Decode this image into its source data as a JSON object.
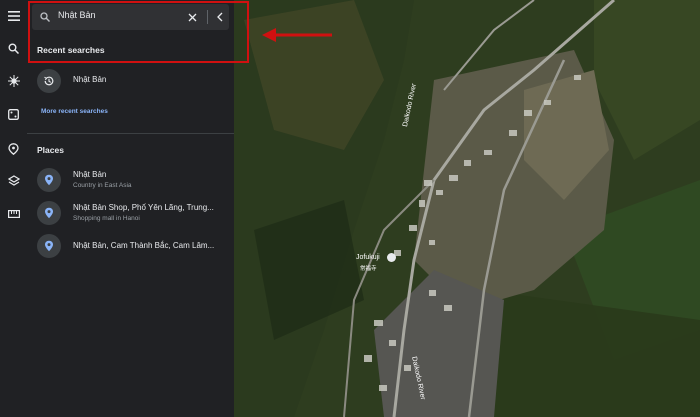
{
  "search": {
    "query": "Nhật Bản"
  },
  "recent": {
    "heading": "Recent searches",
    "items": [
      {
        "title": "Nhật Bản"
      }
    ],
    "more_link": "More recent searches"
  },
  "places": {
    "heading": "Places",
    "items": [
      {
        "title": "Nhật Bản",
        "subtitle": "Country in East Asia"
      },
      {
        "title": "Nhật Bản Shop, Phố Yên Lãng, Trung...",
        "subtitle": "Shopping mall in Hanoi"
      },
      {
        "title": "Nhật Bản, Cam Thành Bắc, Cam Lâm..."
      }
    ]
  },
  "map": {
    "labels": {
      "river_top": "Daikodo River",
      "river_bottom": "Daikodo River",
      "temple": "Jofukuji",
      "temple_jp": "常福寺"
    }
  },
  "colors": {
    "accent": "#8ab4f8",
    "highlight": "#d01010",
    "panel": "#202124"
  }
}
